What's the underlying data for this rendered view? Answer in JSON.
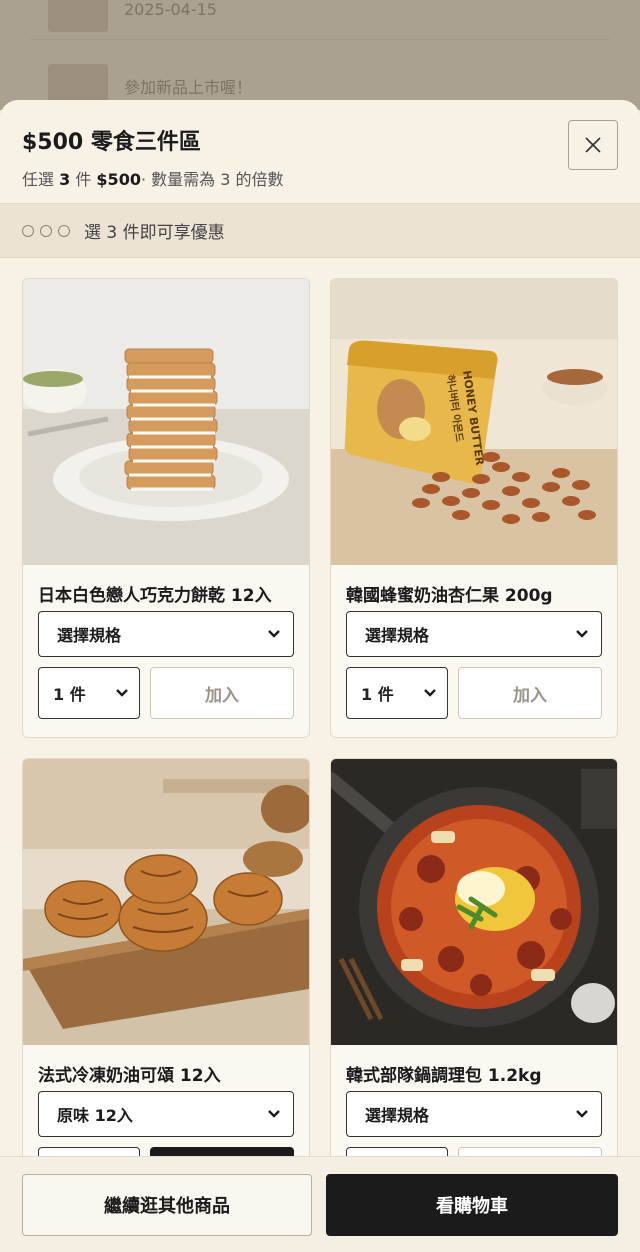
{
  "background": {
    "rows": [
      {
        "text": "2025-04-15"
      },
      {
        "text": "參加新品上市喔！"
      }
    ]
  },
  "sheet": {
    "title": "$500 零食三件區",
    "subtitle_prefix": "任選 ",
    "subtitle_count": "3",
    "subtitle_mid": " 件 ",
    "subtitle_price": "$500",
    "subtitle_suffix": "· 數量需為 3 的倍數",
    "progress_text": "選 3 件即可享優惠"
  },
  "products": [
    {
      "name": "日本白色戀人巧克力餅乾 12入",
      "variant": "選擇規格",
      "qty": "1 件",
      "add_label": "加入"
    },
    {
      "name": "韓國蜂蜜奶油杏仁果 200g",
      "variant": "選擇規格",
      "qty": "1 件",
      "add_label": "加入"
    },
    {
      "name": "法式冷凍奶油可頌 12入",
      "variant": "原味 12入",
      "qty": "",
      "add_label": ""
    },
    {
      "name": "韓式部隊鍋調理包 1.2kg",
      "variant": "選擇規格",
      "qty": "",
      "add_label": ""
    }
  ],
  "bag_text": {
    "brand": "HONEY BUTTER",
    "korean": "허니버터 아몬드"
  },
  "footer": {
    "continue_label": "繼續逛其他商品",
    "cart_label": "看購物車"
  },
  "colors": {
    "accent": "#1b1b1b",
    "sheet_bg": "#f7f1e6"
  }
}
